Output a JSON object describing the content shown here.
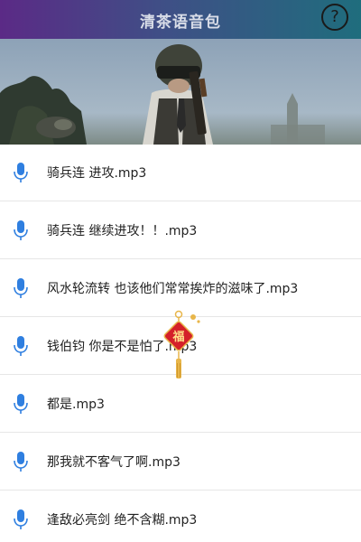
{
  "header": {
    "title": "清茶语音包",
    "help_symbol": "?"
  },
  "banner": {
    "scene": "game-character-banner"
  },
  "list": {
    "items": [
      {
        "label": "骑兵连 进攻.mp3"
      },
      {
        "label": "骑兵连 继续进攻！！.mp3"
      },
      {
        "label": "风水轮流转 也该他们常常挨炸的滋味了.mp3"
      },
      {
        "label": "钱伯钧 你是不是怕了.mp3"
      },
      {
        "label": "都是.mp3"
      },
      {
        "label": "那我就不客气了啊.mp3"
      },
      {
        "label": "逢敌必亮剑 绝不含糊.mp3"
      }
    ]
  },
  "ornament": {
    "text": "福"
  },
  "colors": {
    "header_start": "#5b2a86",
    "header_end": "#1f6d7d",
    "mic_blue": "#2f7fe0",
    "ornament_red": "#d4202a",
    "ornament_gold": "#e8b64a"
  }
}
